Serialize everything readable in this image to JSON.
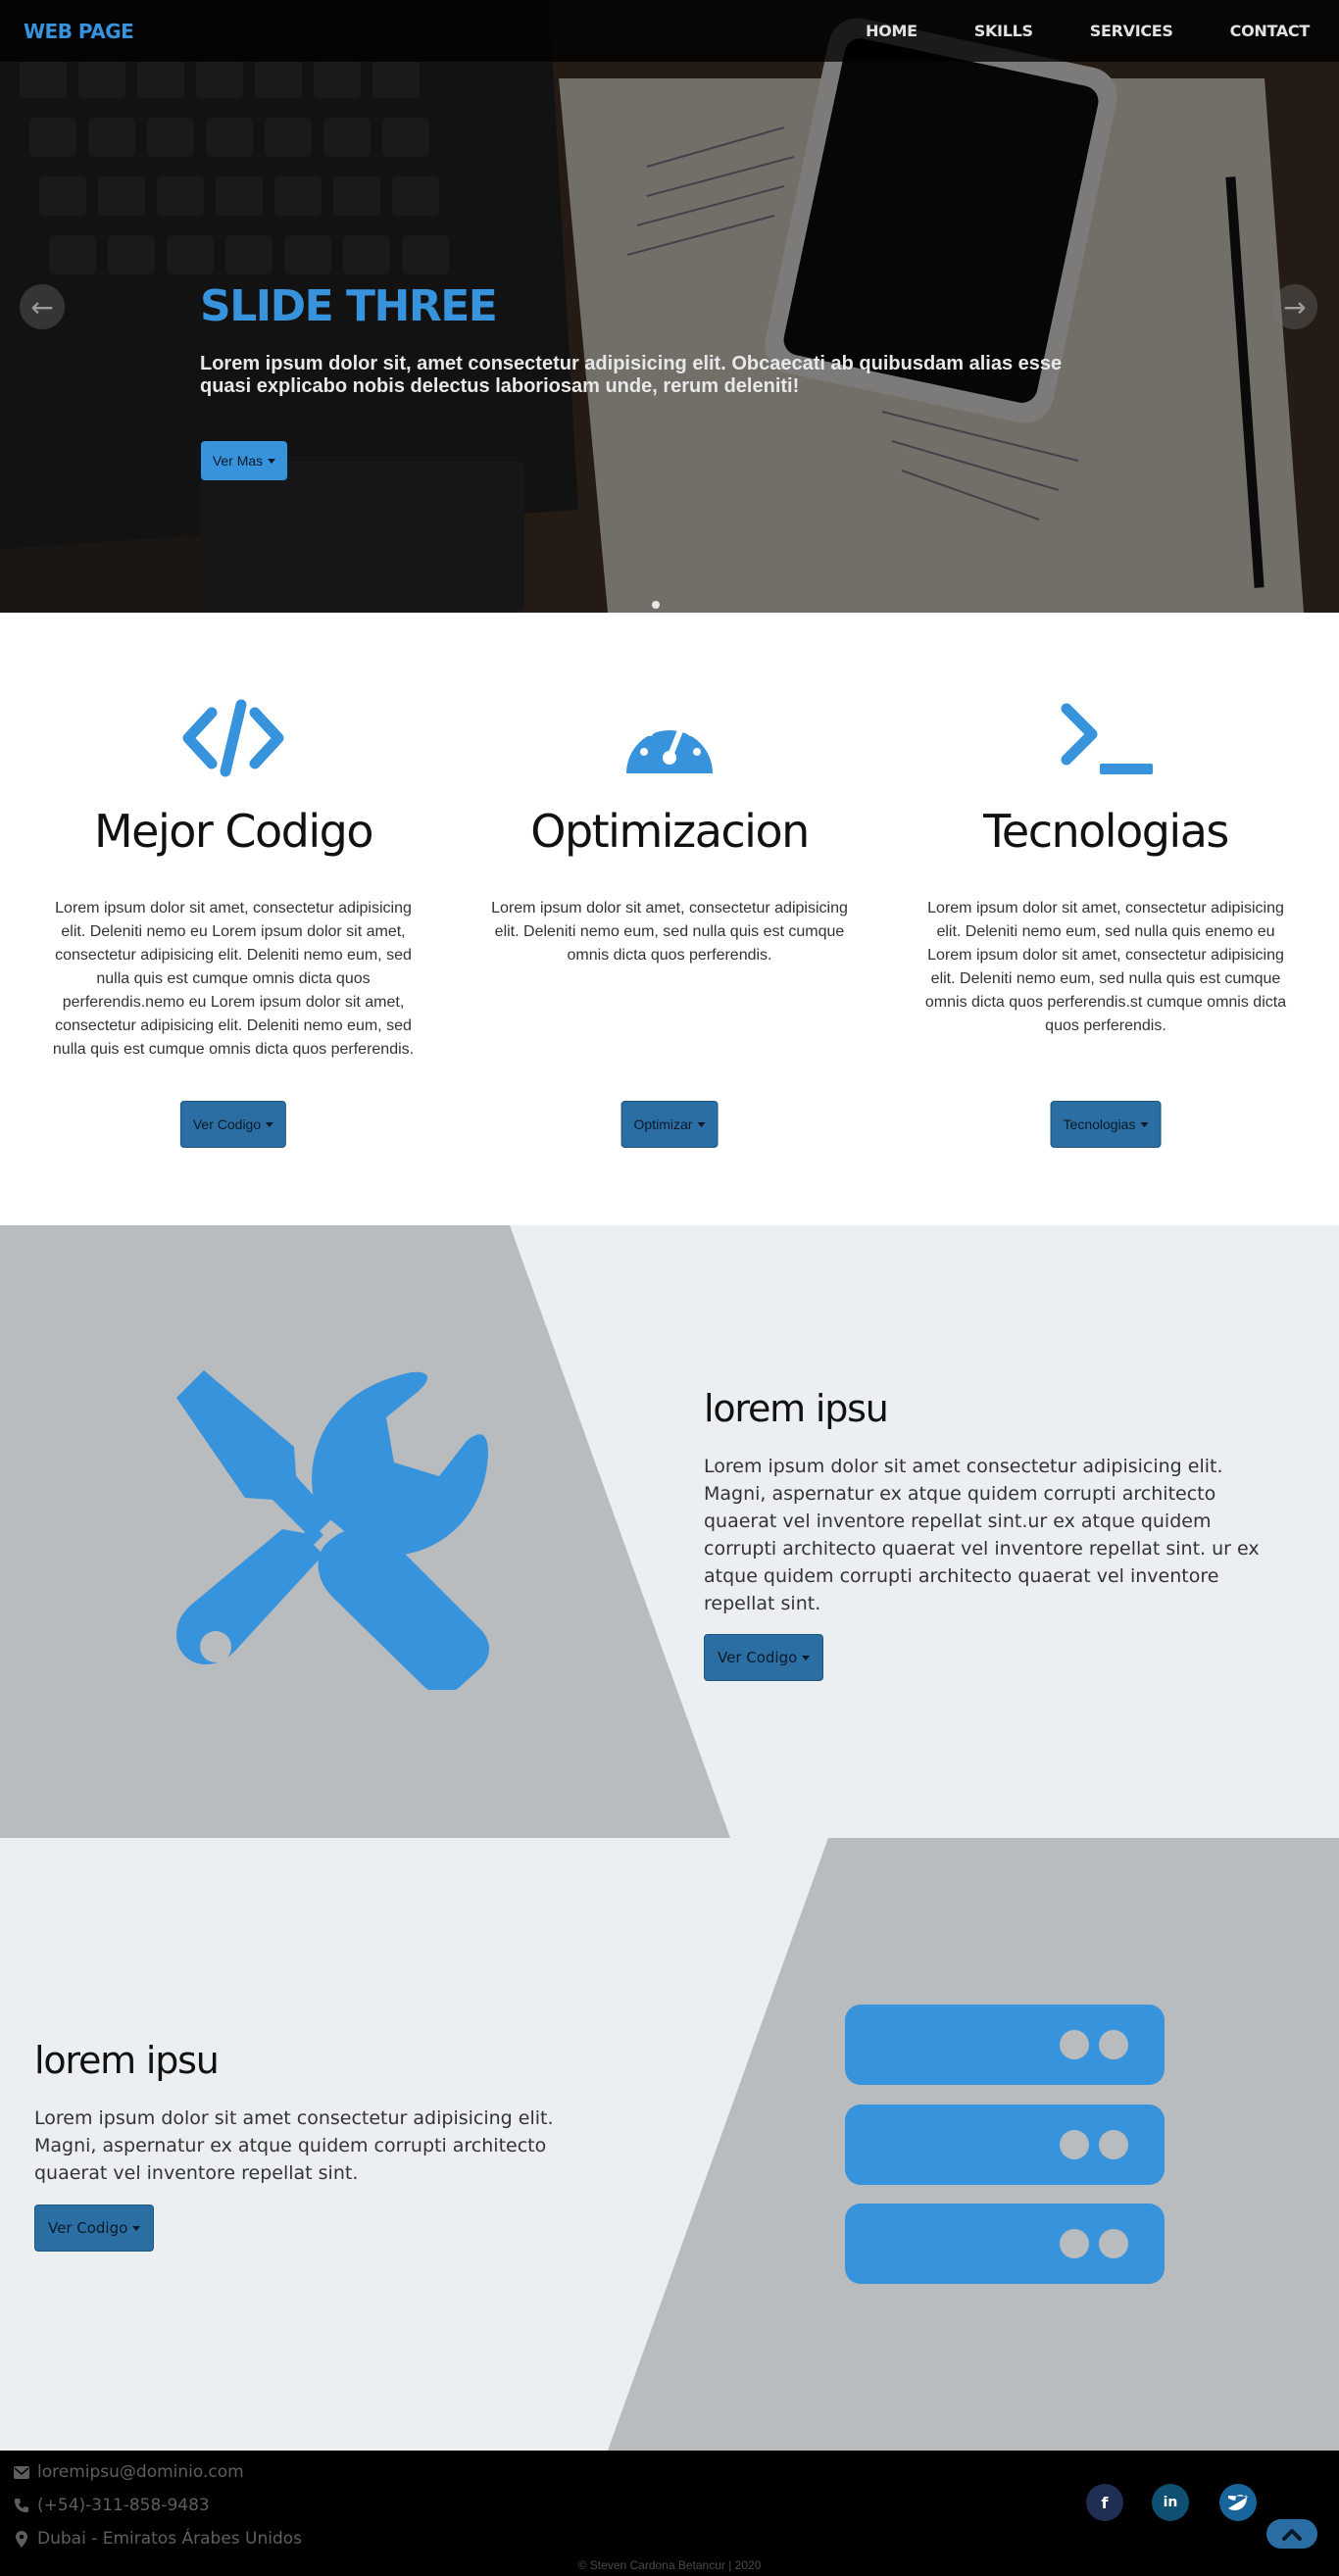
{
  "nav": {
    "brand": "WEB PAGE",
    "items": [
      "HOME",
      "SKILLS",
      "SERVICES",
      "CONTACT"
    ]
  },
  "hero": {
    "title": "SLIDE THREE",
    "text": "Lorem ipsum dolor sit, amet consectetur adipisicing elit. Obcaecati ab quibusdam alias esse quasi explicabo nobis delectus laboriosam unde, rerum deleniti!",
    "button": "Ver Mas"
  },
  "features": [
    {
      "title": "Mejor Codigo",
      "icon": "code-icon",
      "text": "Lorem ipsum dolor sit amet, consectetur adipisicing elit. Deleniti nemo eu Lorem ipsum dolor sit amet, consectetur adipisicing elit. Deleniti nemo eum, sed nulla quis est cumque omnis dicta quos perferendis.nemo eu Lorem ipsum dolor sit amet, consectetur adipisicing elit. Deleniti nemo eum, sed nulla quis est cumque omnis dicta quos perferendis.",
      "button": "Ver Codigo"
    },
    {
      "title": "Optimizacion",
      "icon": "speedometer-icon",
      "text": "Lorem ipsum dolor sit amet, consectetur adipisicing elit. Deleniti nemo eum, sed nulla quis est cumque omnis dicta quos perferendis.",
      "button": "Optimizar"
    },
    {
      "title": "Tecnologias",
      "icon": "terminal-icon",
      "text": "Lorem ipsum dolor sit amet, consectetur adipisicing elit. Deleniti nemo eum, sed nulla quis enemo eu Lorem ipsum dolor sit amet, consectetur adipisicing elit. Deleniti nemo eum, sed nulla quis est cumque omnis dicta quos perferendis.st cumque omnis dicta quos perferendis.",
      "button": "Tecnologias"
    }
  ],
  "section1": {
    "title": "lorem ipsu",
    "icon": "tools-icon",
    "text": "Lorem ipsum dolor sit amet consectetur adipisicing elit. Magni, aspernatur ex atque quidem corrupti architecto quaerat vel inventore repellat sint.ur ex atque quidem corrupti architecto quaerat vel inventore repellat sint. ur ex atque quidem corrupti architecto quaerat vel inventore repellat sint.",
    "button": "Ver Codigo"
  },
  "section2": {
    "title": "lorem ipsu",
    "icon": "server-icon",
    "text": "Lorem ipsum dolor sit amet consectetur adipisicing elit. Magni, aspernatur ex atque quidem corrupti architecto quaerat vel inventore repellat sint.",
    "button": "Ver Codigo"
  },
  "footer": {
    "email": "loremipsu@dominio.com",
    "phone": "(+54)-311-858-9483",
    "location": "Dubai - Emiratos Árabes Unidos",
    "copyright": "© Steven Cardona Betancur | 2020",
    "social": [
      "facebook-icon",
      "linkedin-icon",
      "twitter-icon"
    ]
  },
  "colors": {
    "accent": "#3793dc",
    "button": "#2a6ea4",
    "band_light": "#eceff1",
    "band_dark": "#b9bcbe",
    "footer": "#000000"
  }
}
